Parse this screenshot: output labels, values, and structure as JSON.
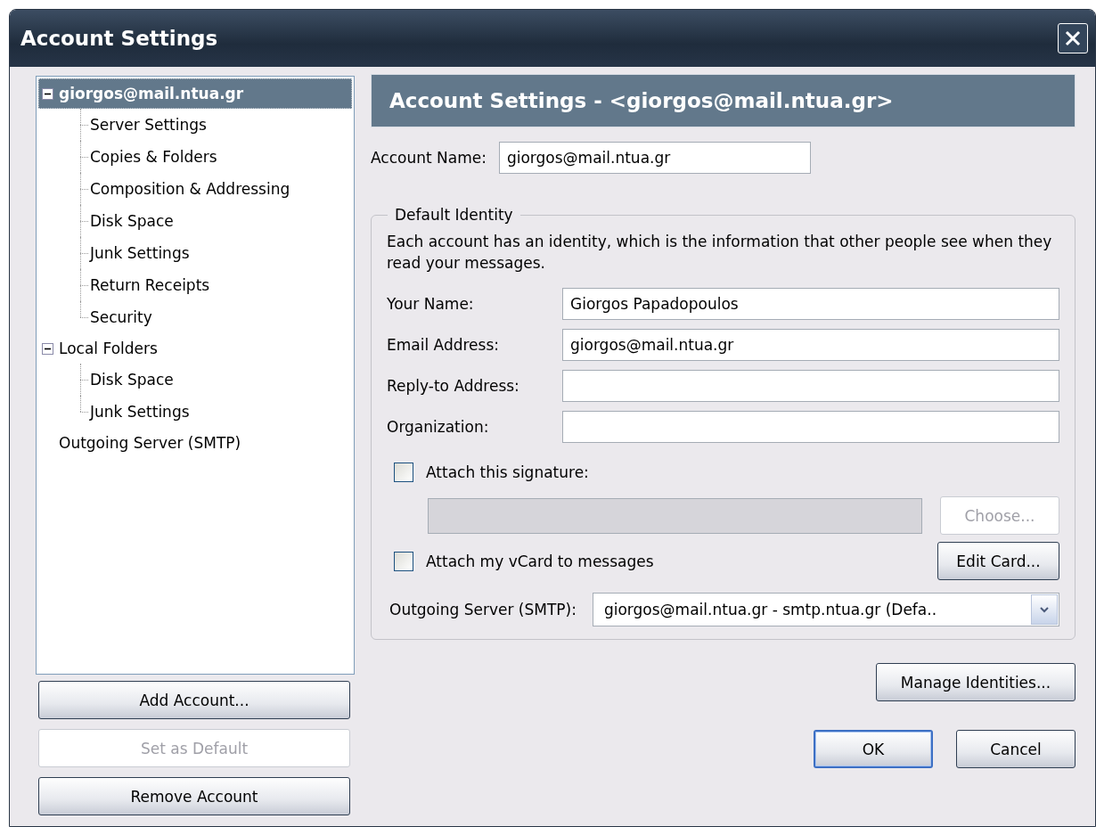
{
  "window": {
    "title": "Account Settings"
  },
  "tree": [
    {
      "label": "giorgos@mail.ntua.gr",
      "selected": true,
      "expanded": true,
      "children": [
        {
          "label": "Server Settings",
          "selected": false
        },
        {
          "label": "Copies & Folders",
          "selected": false
        },
        {
          "label": "Composition & Addressing",
          "selected": false
        },
        {
          "label": "Disk Space",
          "selected": false
        },
        {
          "label": "Junk Settings",
          "selected": false
        },
        {
          "label": "Return Receipts",
          "selected": false
        },
        {
          "label": "Security",
          "selected": false
        }
      ]
    },
    {
      "label": "Local Folders",
      "selected": false,
      "expanded": true,
      "children": [
        {
          "label": "Disk Space",
          "selected": false
        },
        {
          "label": "Junk Settings",
          "selected": false
        }
      ]
    },
    {
      "label": "Outgoing Server (SMTP)",
      "selected": false
    }
  ],
  "left_buttons": [
    {
      "label": "Add Account...",
      "disabled": false
    },
    {
      "label": "Set as Default",
      "disabled": true
    },
    {
      "label": "Remove Account",
      "disabled": false
    }
  ],
  "panel_title": "Account Settings - <giorgos@mail.ntua.gr>",
  "account_name": {
    "label": "Account Name:",
    "value": "giorgos@mail.ntua.gr"
  },
  "identity": {
    "title": "Default Identity",
    "description": "Each account has an identity, which is the information that other people see when they read your messages.",
    "fields": [
      {
        "label": "Your Name:",
        "value": "Giorgos Papadopoulos"
      },
      {
        "label": "Email Address:",
        "value": "giorgos@mail.ntua.gr"
      },
      {
        "label": "Reply-to Address:"
      },
      {
        "label": "Organization:"
      }
    ],
    "signature": {
      "label": "Attach this signature:",
      "checked": false,
      "button": {
        "label": "Choose...",
        "disabled": true
      }
    },
    "vcard": {
      "label": "Attach my vCard to messages",
      "checked": false,
      "button": {
        "label": "Edit Card...",
        "disabled": false
      }
    },
    "outgoing": {
      "label": "Outgoing Server (SMTP):",
      "value": "giorgos@mail.ntua.gr - smtp.ntua.gr (Defa.."
    }
  },
  "manage_button": {
    "label": "Manage Identities..."
  },
  "dialog_buttons": [
    {
      "label": "OK",
      "default": true
    },
    {
      "label": "Cancel",
      "default": false
    }
  ]
}
